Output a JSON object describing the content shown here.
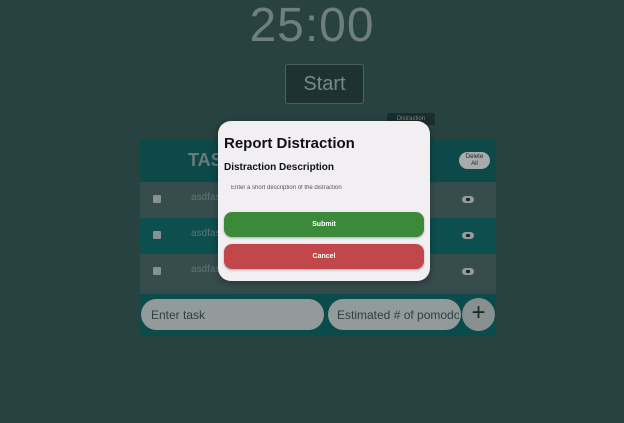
{
  "timer": {
    "value": "25:00"
  },
  "controls": {
    "start_label": "Start",
    "distraction_label": "Distraction"
  },
  "tasks": {
    "title": "TASKS",
    "delete_all_line1": "Delete",
    "delete_all_line2": "All",
    "rows": [
      {
        "text": "asdfas"
      },
      {
        "text": "asdfas"
      },
      {
        "text": "asdfas"
      }
    ],
    "task_placeholder": "Enter task",
    "estimate_placeholder": "Estimated # of pomodoros",
    "add_symbol": "+"
  },
  "modal": {
    "title": "Report Distraction",
    "subtitle": "Distraction Description",
    "description_placeholder": "Enter a short description of the distraction",
    "submit_label": "Submit",
    "cancel_label": "Cancel"
  },
  "colors": {
    "background": "#2e4a4a",
    "submit": "#3a8a3a",
    "cancel": "#c2474a",
    "header": "#0f5454"
  }
}
